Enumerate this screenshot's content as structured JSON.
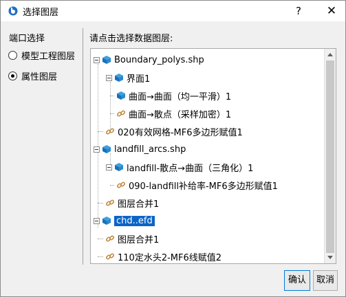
{
  "window": {
    "title": "选择图层",
    "help_label": "?",
    "close_label": "✕"
  },
  "left_panel": {
    "title": "端口选择",
    "options": [
      {
        "label": "模型工程图层",
        "checked": false
      },
      {
        "label": "属性图层",
        "checked": true
      }
    ]
  },
  "right_panel": {
    "title": "请点击选择数据图层:",
    "tree": [
      {
        "label": "Boundary_polys.shp",
        "icon": "layer-cube-icon",
        "level": 0,
        "expandable": true
      },
      {
        "label": "界面1",
        "icon": "layer-cube-icon",
        "level": 1,
        "expandable": true
      },
      {
        "label": "曲面→曲面（均一平滑）1",
        "icon": "layer-cube-icon",
        "level": 2,
        "expandable": false
      },
      {
        "label": "曲面→散点（采样加密）1",
        "icon": "link-icon",
        "level": 2,
        "expandable": false
      },
      {
        "label": "020有效网格-MF6多边形赋值1",
        "icon": "link-icon",
        "level": 1,
        "expandable": false
      },
      {
        "label": "landfill_arcs.shp",
        "icon": "layer-cube-icon",
        "level": 0,
        "expandable": true
      },
      {
        "label": "landfill-散点→曲面（三角化）1",
        "icon": "layer-cube-icon",
        "level": 1,
        "expandable": true
      },
      {
        "label": "090-landfill补给率-MF6多边形赋值1",
        "icon": "link-icon",
        "level": 2,
        "expandable": false
      },
      {
        "label": "图层合并1",
        "icon": "link-icon",
        "level": 1,
        "expandable": false
      },
      {
        "label": "chd..efd",
        "icon": "layer-cube-icon",
        "level": 0,
        "expandable": true,
        "selected": true
      },
      {
        "label": "图层合并1",
        "icon": "link-icon",
        "level": 1,
        "expandable": false
      },
      {
        "label": "110定水头2-MF6线赋值2",
        "icon": "link-icon",
        "level": 1,
        "expandable": false
      }
    ]
  },
  "buttons": {
    "ok": "确认",
    "cancel": "取消"
  },
  "colors": {
    "selection": "#0a64c8",
    "cube_top": "#3ca0e0",
    "cube_side": "#1a6fb8",
    "link": "#c08a40"
  }
}
